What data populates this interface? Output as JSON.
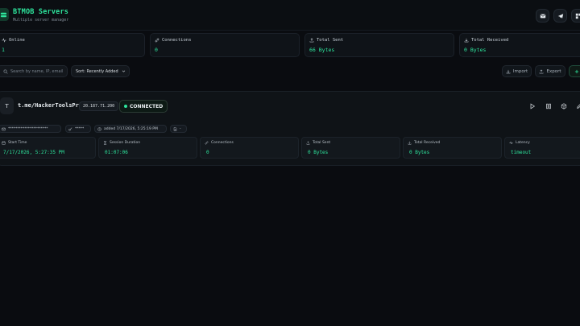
{
  "app": {
    "title": "BTMOB Servers",
    "subtitle": "Multiple server manager",
    "accent": "#2ee59d"
  },
  "header": {
    "icons": [
      "mail-icon",
      "telegram-icon",
      "grid-icon"
    ]
  },
  "stats": [
    {
      "label": "Online",
      "value": "1",
      "icon": "activity-icon"
    },
    {
      "label": "Connections",
      "value": "0",
      "icon": "link-icon"
    },
    {
      "label": "Total Sent",
      "value": "66 Bytes",
      "icon": "upload-icon"
    },
    {
      "label": "Total Received",
      "value": "0 Bytes",
      "icon": "download-icon"
    }
  ],
  "toolbar": {
    "search_placeholder": "Search by name, IP, email",
    "sort_label": "Sort: Recently Added",
    "import_label": "Import",
    "export_label": "Export"
  },
  "server": {
    "avatar": "T",
    "name": "t.me/HackerToolsPro",
    "ip": "20.187.71.200",
    "status": "CONNECTED",
    "email_masked": "**********************",
    "key_masked": "*****",
    "added": "added 7/17/2026, 5:25:19 PM",
    "notes": "-",
    "metrics": [
      {
        "label": "Start Time",
        "value": "7/17/2026, 5:27:35 PM",
        "icon": "calendar-icon"
      },
      {
        "label": "Session Duration",
        "value": "01:07:06",
        "icon": "hourglass-icon"
      },
      {
        "label": "Connections",
        "value": "0",
        "icon": "link-icon"
      },
      {
        "label": "Total Sent",
        "value": "0 Bytes",
        "icon": "upload-icon"
      },
      {
        "label": "Total Received",
        "value": "0 Bytes",
        "icon": "download-icon"
      },
      {
        "label": "Latency",
        "value": "timeout",
        "icon": "activity-icon"
      }
    ]
  }
}
